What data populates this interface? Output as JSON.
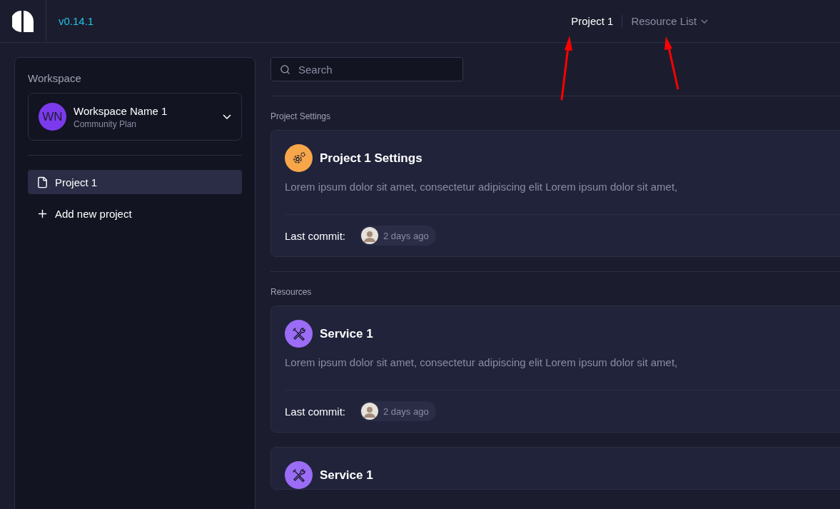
{
  "header": {
    "version": "v0.14.1",
    "breadcrumb": [
      {
        "label": "Project 1",
        "selected": true,
        "dropdown": false
      },
      {
        "label": "Resource List",
        "selected": false,
        "dropdown": true
      }
    ]
  },
  "sidebar": {
    "title": "Workspace",
    "workspace": {
      "initials": "WN",
      "name": "Workspace Name 1",
      "plan": "Community Plan"
    },
    "items": [
      {
        "label": "Project 1",
        "kind": "project",
        "selected": true
      },
      {
        "label": "Add new project",
        "kind": "add",
        "selected": false
      }
    ]
  },
  "search": {
    "placeholder": "Search"
  },
  "sections": [
    {
      "title": "Project Settings",
      "cards": [
        {
          "kind": "settings",
          "title": "Project 1 Settings",
          "description": "Lorem ipsum dolor sit amet, consectetur adipiscing elit Lorem ipsum dolor sit amet,",
          "commit_label": "Last commit:",
          "commit_time": "2 days ago"
        }
      ]
    },
    {
      "title": "Resources",
      "cards": [
        {
          "kind": "service",
          "title": "Service 1",
          "description": "Lorem ipsum dolor sit amet, consectetur adipiscing elit Lorem ipsum dolor sit amet,",
          "commit_label": "Last commit:",
          "commit_time": "2 days ago"
        },
        {
          "kind": "service",
          "title": "Service 1"
        }
      ]
    }
  ]
}
